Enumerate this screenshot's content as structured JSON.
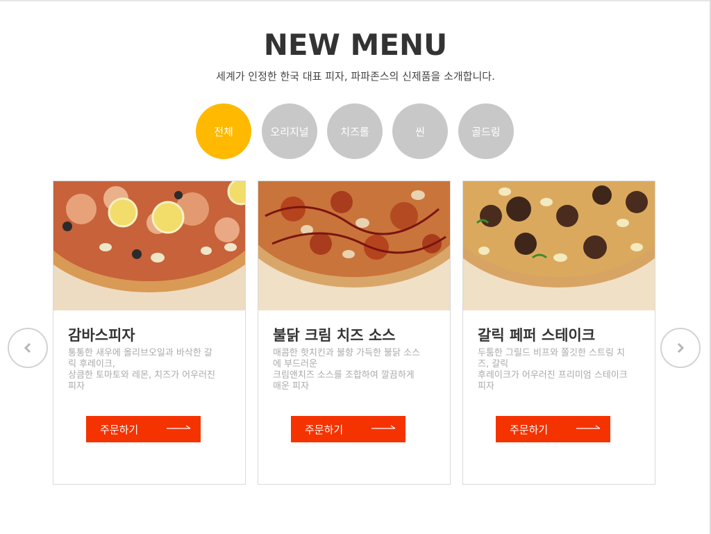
{
  "header": {
    "title": "NEW MENU",
    "subtitle": "세계가 인정한 한국 대표 피자, 파파존스의 신제품을 소개합니다."
  },
  "tabs": [
    {
      "label": "전체",
      "active": true
    },
    {
      "label": "오리지널",
      "active": false
    },
    {
      "label": "치즈롤",
      "active": false
    },
    {
      "label": "씬",
      "active": false
    },
    {
      "label": "골드링",
      "active": false
    }
  ],
  "products": [
    {
      "name": "감바스피자",
      "desc_lines": [
        "통통한 새우에 올리브오일과 바삭한 갈",
        "릭 후레이크,",
        "상큼한 토마토와 레몬, 치즈가 어우러진",
        "피자"
      ],
      "button_label": "주문하기",
      "image": "pizza-shrimp-lemon-image"
    },
    {
      "name": "불닭 크림 치즈 소스",
      "desc_lines": [
        "매콤한 핫치킨과 불향 가득한 불닭 소스",
        "에 부드러운",
        "크림앤치즈 소스를 조합하여 깔끔하게",
        "매운 피자"
      ],
      "button_label": "주문하기",
      "image": "pizza-spicy-chicken-image"
    },
    {
      "name": "갈릭 페퍼 스테이크",
      "desc_lines": [
        "두툼한 그릴드 비프와 쫄깃한 스트링 치",
        "즈, 갈릭",
        "후레이크가 어우러진 프리미엄 스테이크",
        "피자"
      ],
      "button_label": "주문하기",
      "image": "pizza-garlic-steak-image"
    }
  ],
  "carousel": {
    "prev_icon": "chevron-left-icon",
    "next_icon": "chevron-right-icon"
  },
  "colors": {
    "accent_tab": "#ffb900",
    "inactive_tab": "#c8c8c8",
    "order_button": "#f53300",
    "desc_text": "#aaaaaa"
  }
}
